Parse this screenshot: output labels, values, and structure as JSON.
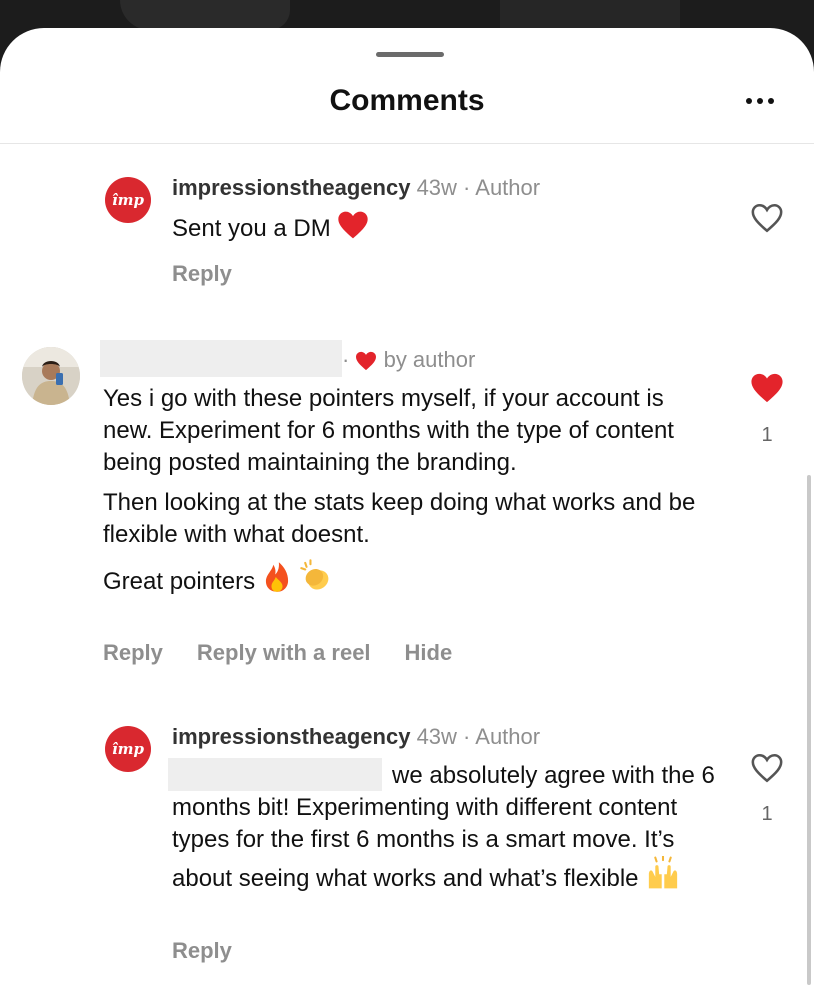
{
  "sheet": {
    "title": "Comments"
  },
  "comments": [
    {
      "username": "impressionstheagency",
      "time": "43w",
      "sep": " · ",
      "tag": "Author",
      "avatar_text": "împ",
      "text": "Sent you a DM",
      "actions": [
        "Reply"
      ],
      "liked": false,
      "like_count": ""
    },
    {
      "liked_by_author": "by author",
      "sep": "· ",
      "paragraphs": [
        "Yes i go with these pointers myself, if your account is new. Experiment for 6 months with the type of content being posted maintaining the branding.",
        "Then looking at the stats keep doing what works and be flexible with what doesnt.",
        "Great pointers"
      ],
      "actions": [
        "Reply",
        "Reply with a reel",
        "Hide"
      ],
      "liked": true,
      "like_count": "1"
    },
    {
      "username": "impressionstheagency",
      "time": "43w",
      "sep": " · ",
      "tag": "Author",
      "avatar_text": "împ",
      "text": "we absolutely agree with the 6 months bit! Experimenting with different content types for the first 6 months is a smart move. It’s about seeing what works and what’s flexible",
      "actions": [
        "Reply"
      ],
      "liked": false,
      "like_count": "1"
    }
  ],
  "colors": {
    "brand": "#d9282f",
    "heart": "#e3242b",
    "muted": "#8e8e8e"
  }
}
